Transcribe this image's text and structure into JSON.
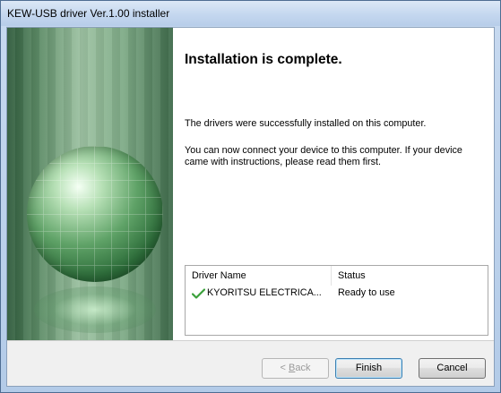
{
  "window": {
    "title": "KEW-USB driver Ver.1.00 installer"
  },
  "content": {
    "heading": "Installation is complete.",
    "paragraph1": "The drivers were successfully installed on this computer.",
    "paragraph2_line1": "You can now connect your device to this computer. If your device",
    "paragraph2_line2": "came with instructions, please read them first."
  },
  "driver_table": {
    "columns": [
      "Driver Name",
      "Status"
    ],
    "rows": [
      {
        "icon": "green-check-icon",
        "name": "KYORITSU ELECTRICA...",
        "status": "Ready to use"
      }
    ]
  },
  "buttons": {
    "back_prefix": "< ",
    "back_mnemonic": "B",
    "back_rest": "ack",
    "finish": "Finish",
    "cancel": "Cancel"
  },
  "colors": {
    "check": "#3aa03a",
    "banner": "#5b8a65"
  }
}
